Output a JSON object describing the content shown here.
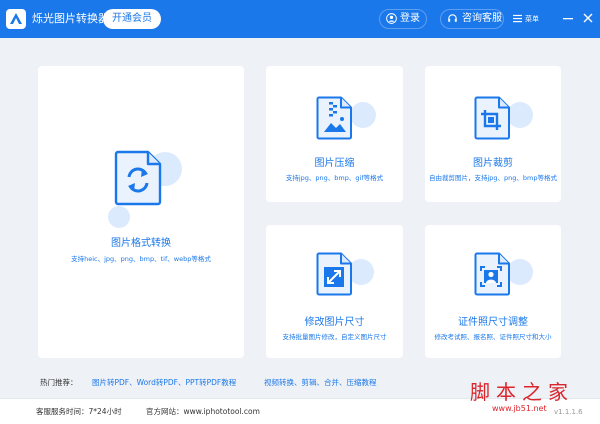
{
  "app": {
    "title": "烁光图片转换器",
    "vip_label": "开通会员"
  },
  "header": {
    "login_label": "登录",
    "support_label": "咨询客服",
    "menu_label": "菜单"
  },
  "colors": {
    "primary": "#1b78ea",
    "content_bg": "#eef1f6",
    "icon_light": "#dceafd"
  },
  "tools": {
    "format": {
      "title": "图片格式转换",
      "desc": "支持heic、jpg、png、bmp、tif、webp等格式",
      "icon": "refresh-arrows-icon"
    },
    "compress": {
      "title": "图片压缩",
      "desc": "支持jpg、png、bmp、gif等格式",
      "icon": "zip-image-icon"
    },
    "crop": {
      "title": "图片裁剪",
      "desc": "自由裁剪图片，支持jpg、png、bmp等格式",
      "icon": "crop-icon"
    },
    "resize": {
      "title": "修改图片尺寸",
      "desc": "支持批量图片修改，自定义图片尺寸",
      "icon": "resize-arrow-icon"
    },
    "idphoto": {
      "title": "证件照尺寸调整",
      "desc": "修改考试照、报名照、证件照尺寸和大小",
      "icon": "id-photo-icon"
    }
  },
  "hot": {
    "label": "热门推荐：",
    "links": [
      "图片转PDF、Word转PDF、PPT转PDF教程",
      "视频转换、剪辑、合并、压缩教程"
    ]
  },
  "footer": {
    "service_time": "客服服务时间：7*24小时",
    "website": "官方网站：www.iphototool.com",
    "version": "v1.1.1.6"
  },
  "watermark": {
    "text": "脚本之家",
    "url": "www.jb51.net"
  }
}
